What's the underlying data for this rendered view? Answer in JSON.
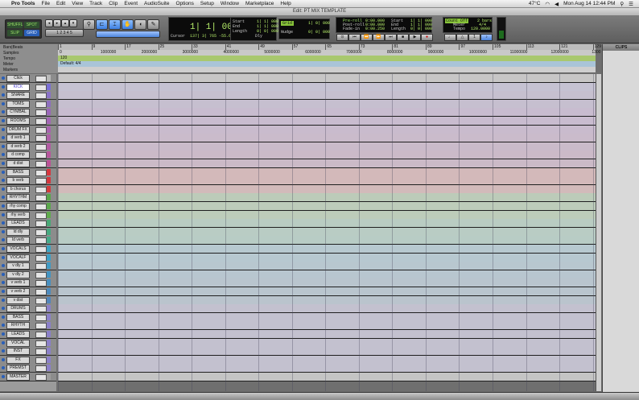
{
  "menubar": {
    "apple": "",
    "app": "Pro Tools",
    "items": [
      "File",
      "Edit",
      "View",
      "Track",
      "Clip",
      "Event",
      "AudioSuite",
      "Options",
      "Setup",
      "Window",
      "Marketplace",
      "Help"
    ],
    "status": {
      "temp": "47°C",
      "clock": "Mon Aug 14  12:44 PM"
    }
  },
  "window": {
    "title": "Edit: PT MIX TEMPLATE"
  },
  "toolbar": {
    "mode_labels": [
      "SHUFFLE",
      "SPOT",
      "SLIP",
      "GRID"
    ],
    "main_counter": "1| 1| 000",
    "counter_start_label": "Start",
    "counter_end_label": "End",
    "counter_length_label": "Length",
    "counter_start": "1| 1| 000",
    "counter_end": "1| 1| 000",
    "counter_length": "0| 0| 000",
    "cursor_label": "Cursor",
    "cursor_value": "137| 3| 765",
    "db_value": "-55.6 db",
    "dly_label": "Dly",
    "grid_label": "Grid",
    "grid_value": "1| 0| 000",
    "nudge_label": "Nudge",
    "nudge_value": "0| 0| 000",
    "preroll_label": "Pre-roll",
    "postroll_label": "Post-roll",
    "fadein_label": "Fade-in",
    "preroll_value": "0:00.000",
    "postroll_value": "0:00.000",
    "fadein_value": "0:00.250",
    "tstart_label": "Start",
    "tend_label": "End",
    "tlength_label": "Length",
    "tstart_value": "1| 1| 000",
    "tend_value": "1| 1| 000",
    "tlength_value": "0| 0| 000",
    "countoff_label": "Count Off",
    "countoff_value": "2 bars",
    "meter_label": "Meter",
    "meter_value": "4/4",
    "tempo_label": "Tempo",
    "tempo_value": "120.0000"
  },
  "rulers": {
    "rows": [
      "Bars|Beats",
      "Samples",
      "Tempo",
      "Meter",
      "Markers"
    ],
    "bar_ticks": [
      "1",
      "9",
      "17",
      "25",
      "33",
      "41",
      "49",
      "57",
      "65",
      "73",
      "81",
      "89",
      "97",
      "105",
      "113",
      "121",
      "129"
    ],
    "sample_ticks": [
      "0",
      "1000000",
      "2000000",
      "3000000",
      "4000000",
      "5000000",
      "6000000",
      "7000000",
      "8000000",
      "9000000",
      "10000000",
      "11000000",
      "12000000",
      "1300"
    ],
    "tempo_marker": "120",
    "meter_marker": "Default: 4/4"
  },
  "tracks": [
    {
      "name": "Click",
      "color": "#b9b9b9",
      "lane": "#c7c6c6"
    },
    {
      "name": "KICK",
      "color": "#7a6fd6",
      "lane": "#c5c2d2",
      "sel": true
    },
    {
      "name": "SNARE",
      "color": "#8a72c8",
      "lane": "#c6c0cf"
    },
    {
      "name": "TOMS",
      "color": "#8e6fbf",
      "lane": "#c6bfcf"
    },
    {
      "name": "CYMBAL",
      "color": "#9a67b9",
      "lane": "#c8bccf"
    },
    {
      "name": "ROOMS",
      "color": "#a366b5",
      "lane": "#c9bccf"
    },
    {
      "name": "DRUM FX",
      "color": "#a863af",
      "lane": "#c9bbcd"
    },
    {
      "name": "d verb 1",
      "color": "#ae5fa8",
      "lane": "#cabbcb"
    },
    {
      "name": "d verb 2",
      "color": "#b25ba3",
      "lane": "#cabbca"
    },
    {
      "name": "d comp",
      "color": "#b7569d",
      "lane": "#cbbac8"
    },
    {
      "name": "d dist",
      "color": "#bb5296",
      "lane": "#cbbac7"
    },
    {
      "name": "BASS",
      "color": "#d6363e",
      "lane": "#d3b9ba"
    },
    {
      "name": "b verb",
      "color": "#d4363d",
      "lane": "#d3b9ba"
    },
    {
      "name": "b chorus",
      "color": "#d33a3b",
      "lane": "#d2baba"
    },
    {
      "name": "RHYTHM",
      "color": "#58a64a",
      "lane": "#bccbb9"
    },
    {
      "name": "rhy comp",
      "color": "#5aa84b",
      "lane": "#bdccba"
    },
    {
      "name": "rhy verb",
      "color": "#5fab4c",
      "lane": "#bdccba"
    },
    {
      "name": "LEADS",
      "color": "#49a876",
      "lane": "#b9ccc2"
    },
    {
      "name": "ld dly",
      "color": "#46a97f",
      "lane": "#b9ccc4"
    },
    {
      "name": "ld verb",
      "color": "#44aa88",
      "lane": "#b8ccc5"
    },
    {
      "name": "VOCALS",
      "color": "#3aa3c3",
      "lane": "#b7c9d0"
    },
    {
      "name": "VOCALF",
      "color": "#3b9fc6",
      "lane": "#b7c8d0"
    },
    {
      "name": "v dly 1",
      "color": "#3f9ac4",
      "lane": "#b8c7cf"
    },
    {
      "name": "v dly 2",
      "color": "#4394c2",
      "lane": "#b8c6cf"
    },
    {
      "name": "v verb 1",
      "color": "#488fbf",
      "lane": "#b9c5ce"
    },
    {
      "name": "v verb 2",
      "color": "#4c8abd",
      "lane": "#b9c5ce"
    },
    {
      "name": "v dist",
      "color": "#5185ba",
      "lane": "#bac4cd"
    },
    {
      "name": "DRUMS",
      "color": "#8b80c9",
      "lane": "#c3c1cf"
    },
    {
      "name": "BASS",
      "color": "#8b80c9",
      "lane": "#c3c1cf"
    },
    {
      "name": "RHYTH",
      "color": "#8b80c9",
      "lane": "#c3c1cf"
    },
    {
      "name": "LEADS",
      "color": "#8b80c9",
      "lane": "#c3c1cf"
    },
    {
      "name": "VOCAL",
      "color": "#8b80c9",
      "lane": "#c3c1cf"
    },
    {
      "name": "INST",
      "color": "#8b80c9",
      "lane": "#c3c1cf"
    },
    {
      "name": "FX",
      "color": "#8b80c9",
      "lane": "#c3c1cf"
    },
    {
      "name": "PREMST",
      "color": "#8b80c9",
      "lane": "#c3c1cf"
    },
    {
      "name": "MASTER",
      "color": "#9c9c9c",
      "lane": "#c4c4c4"
    }
  ],
  "clips": {
    "title": "CLIPS"
  }
}
